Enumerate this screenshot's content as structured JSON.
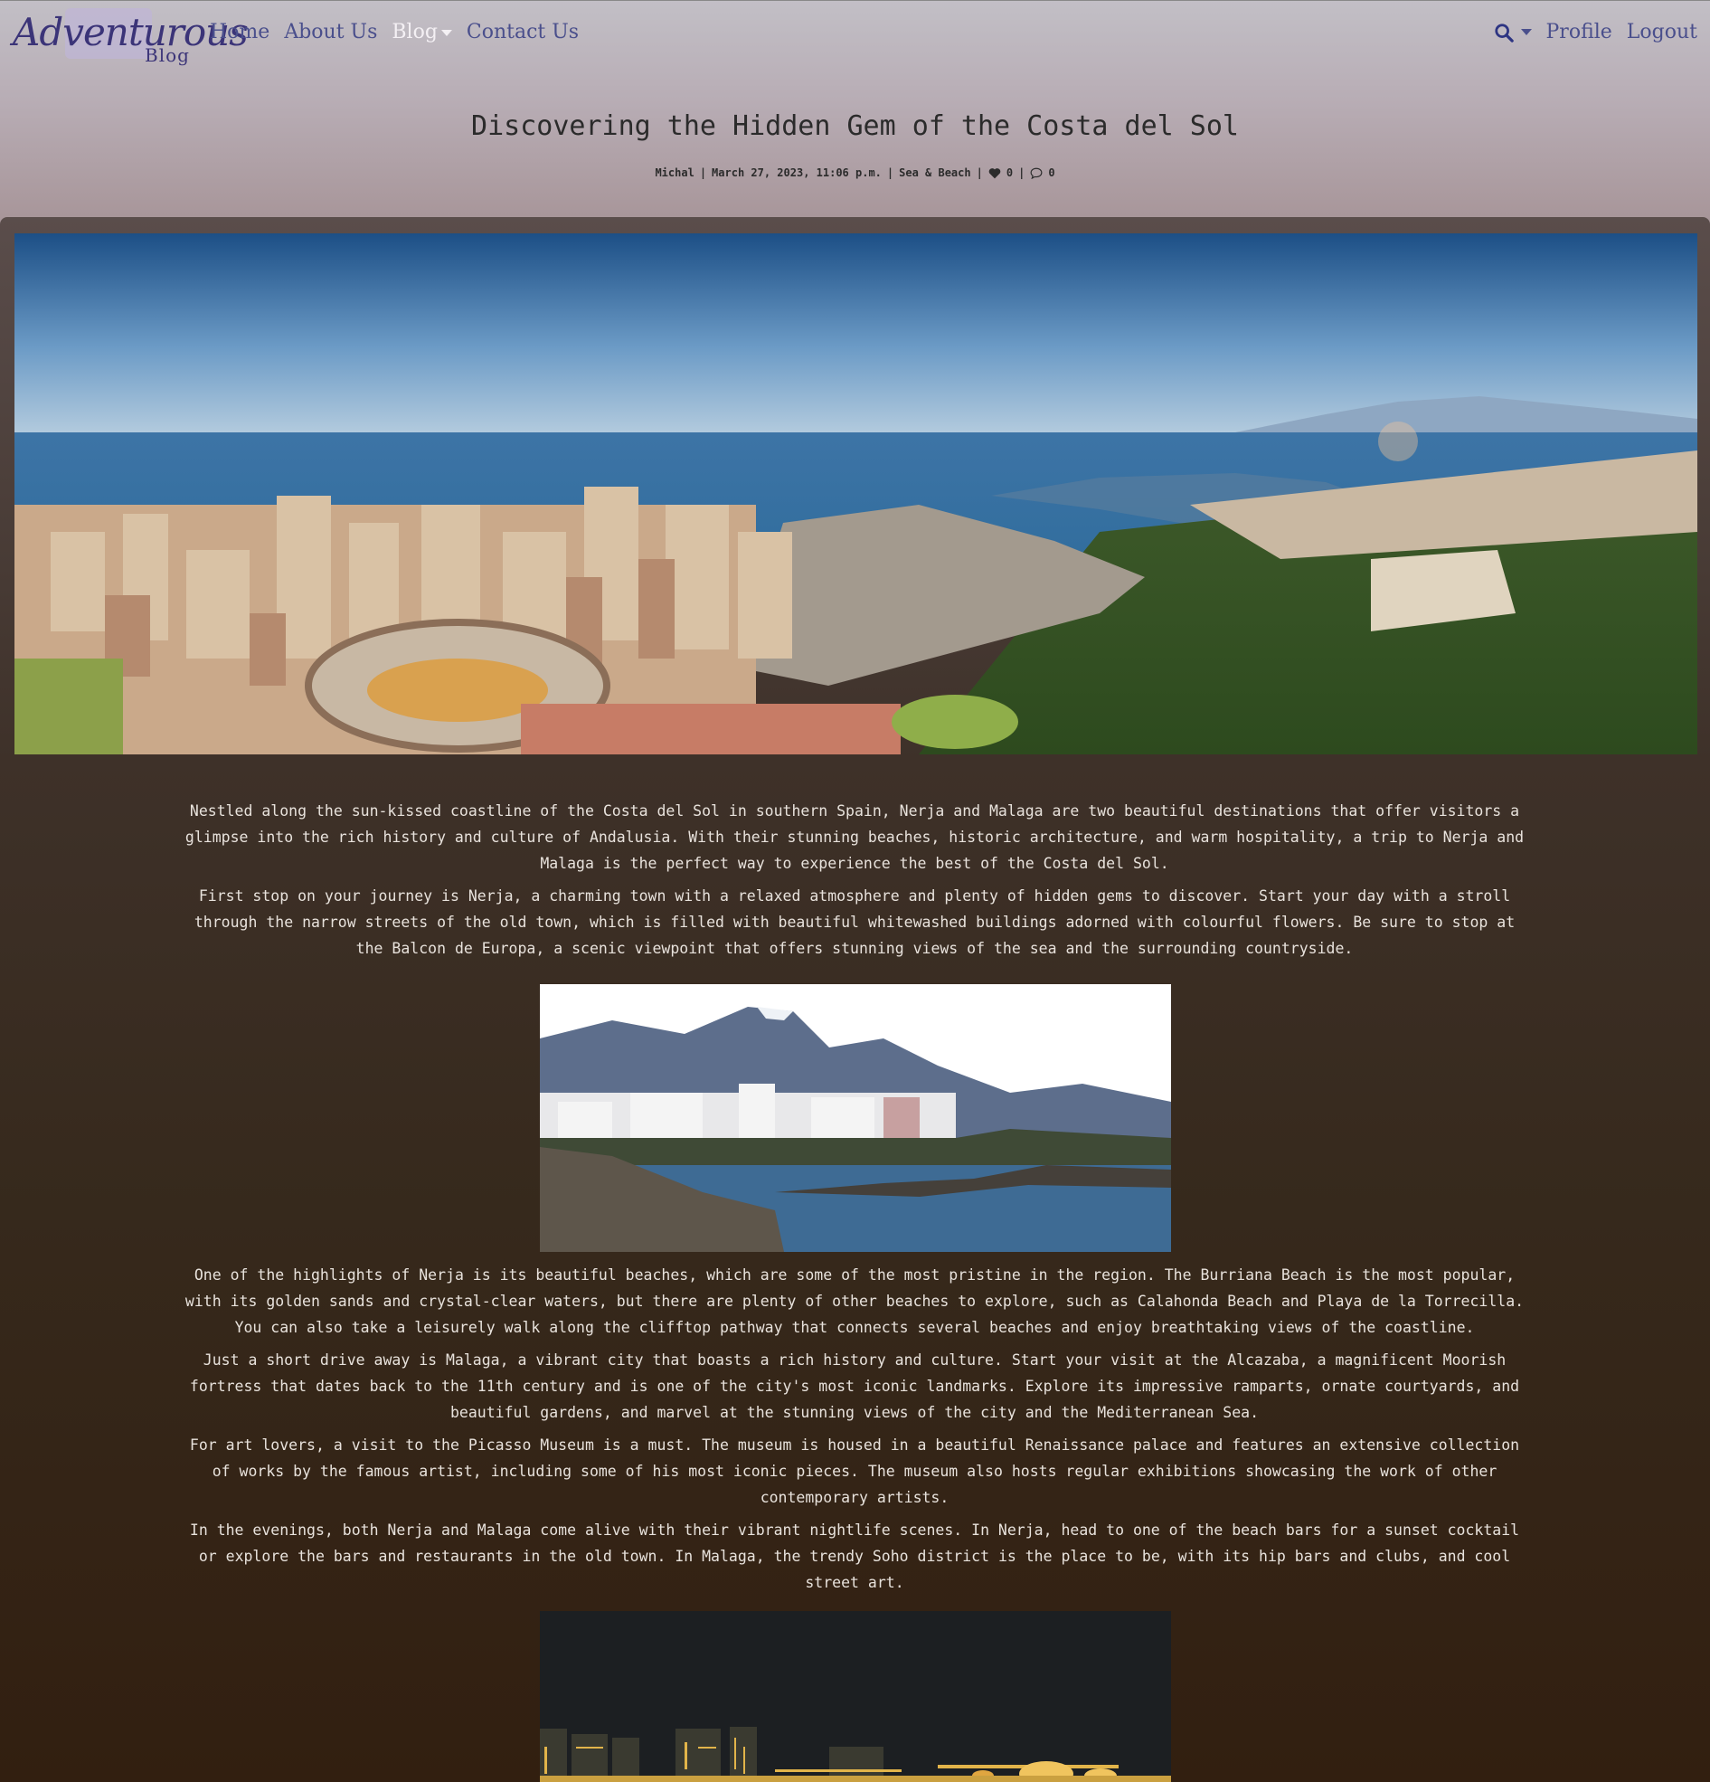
{
  "brand": {
    "name": "Adventurous",
    "sub": "Blog"
  },
  "nav": {
    "items": [
      {
        "label": "Home"
      },
      {
        "label": "About Us"
      },
      {
        "label": "Blog"
      },
      {
        "label": "Contact Us"
      }
    ],
    "right": [
      {
        "label": "Profile"
      },
      {
        "label": "Logout"
      }
    ]
  },
  "post": {
    "title": "Discovering the Hidden Gem of the Costa del Sol",
    "author": "Michal",
    "date": "March 27, 2023, 11:06 p.m.",
    "category": "Sea & Beach",
    "likes": "0",
    "comments": "0",
    "separator": "|",
    "paragraphs": [
      "Nestled along the sun-kissed coastline of the Costa del Sol in southern Spain, Nerja and Malaga are two beautiful destinations that offer visitors a glimpse into the rich history and culture of Andalusia. With their stunning beaches, historic architecture, and warm hospitality, a trip to Nerja and Malaga is the perfect way to experience the best of the Costa del Sol.",
      "First stop on your journey is Nerja, a charming town with a relaxed atmosphere and plenty of hidden gems to discover. Start your day with a stroll through the narrow streets of the old town, which is filled with beautiful whitewashed buildings adorned with colourful flowers. Be sure to stop at the Balcon de Europa, a scenic viewpoint that offers stunning views of the sea and the surrounding countryside.",
      "One of the highlights of Nerja is its beautiful beaches, which are some of the most pristine in the region. The Burriana Beach is the most popular, with its golden sands and crystal-clear waters, but there are plenty of other beaches to explore, such as Calahonda Beach and Playa de la Torrecilla. You can also take a leisurely walk along the clifftop pathway that connects several beaches and enjoy breathtaking views of the coastline.",
      "Just a short drive away is Malaga, a vibrant city that boasts a rich history and culture. Start your visit at the Alcazaba, a magnificent Moorish fortress that dates back to the 11th century and is one of the city's most iconic landmarks. Explore its impressive ramparts, ornate courtyards, and beautiful gardens, and marvel at the stunning views of the city and the Mediterranean Sea.",
      "For art lovers, a visit to the Picasso Museum is a must. The museum is housed in a beautiful Renaissance palace and features an extensive collection of works by the famous artist, including some of his most iconic pieces. The museum also hosts regular exhibitions showcasing the work of other contemporary artists.",
      "In the evenings, both Nerja and Malaga come alive with their vibrant nightlife scenes. In Nerja, head to one of the beach bars for a sunset cocktail or explore the bars and restaurants in the old town. In Malaga, the trendy Soho district is the place to be, with its hip bars and clubs, and cool street art."
    ]
  },
  "colors": {
    "nav_link": "#4a4f8c",
    "brand": "#3b3478",
    "body_text": "#e8e2dc"
  }
}
